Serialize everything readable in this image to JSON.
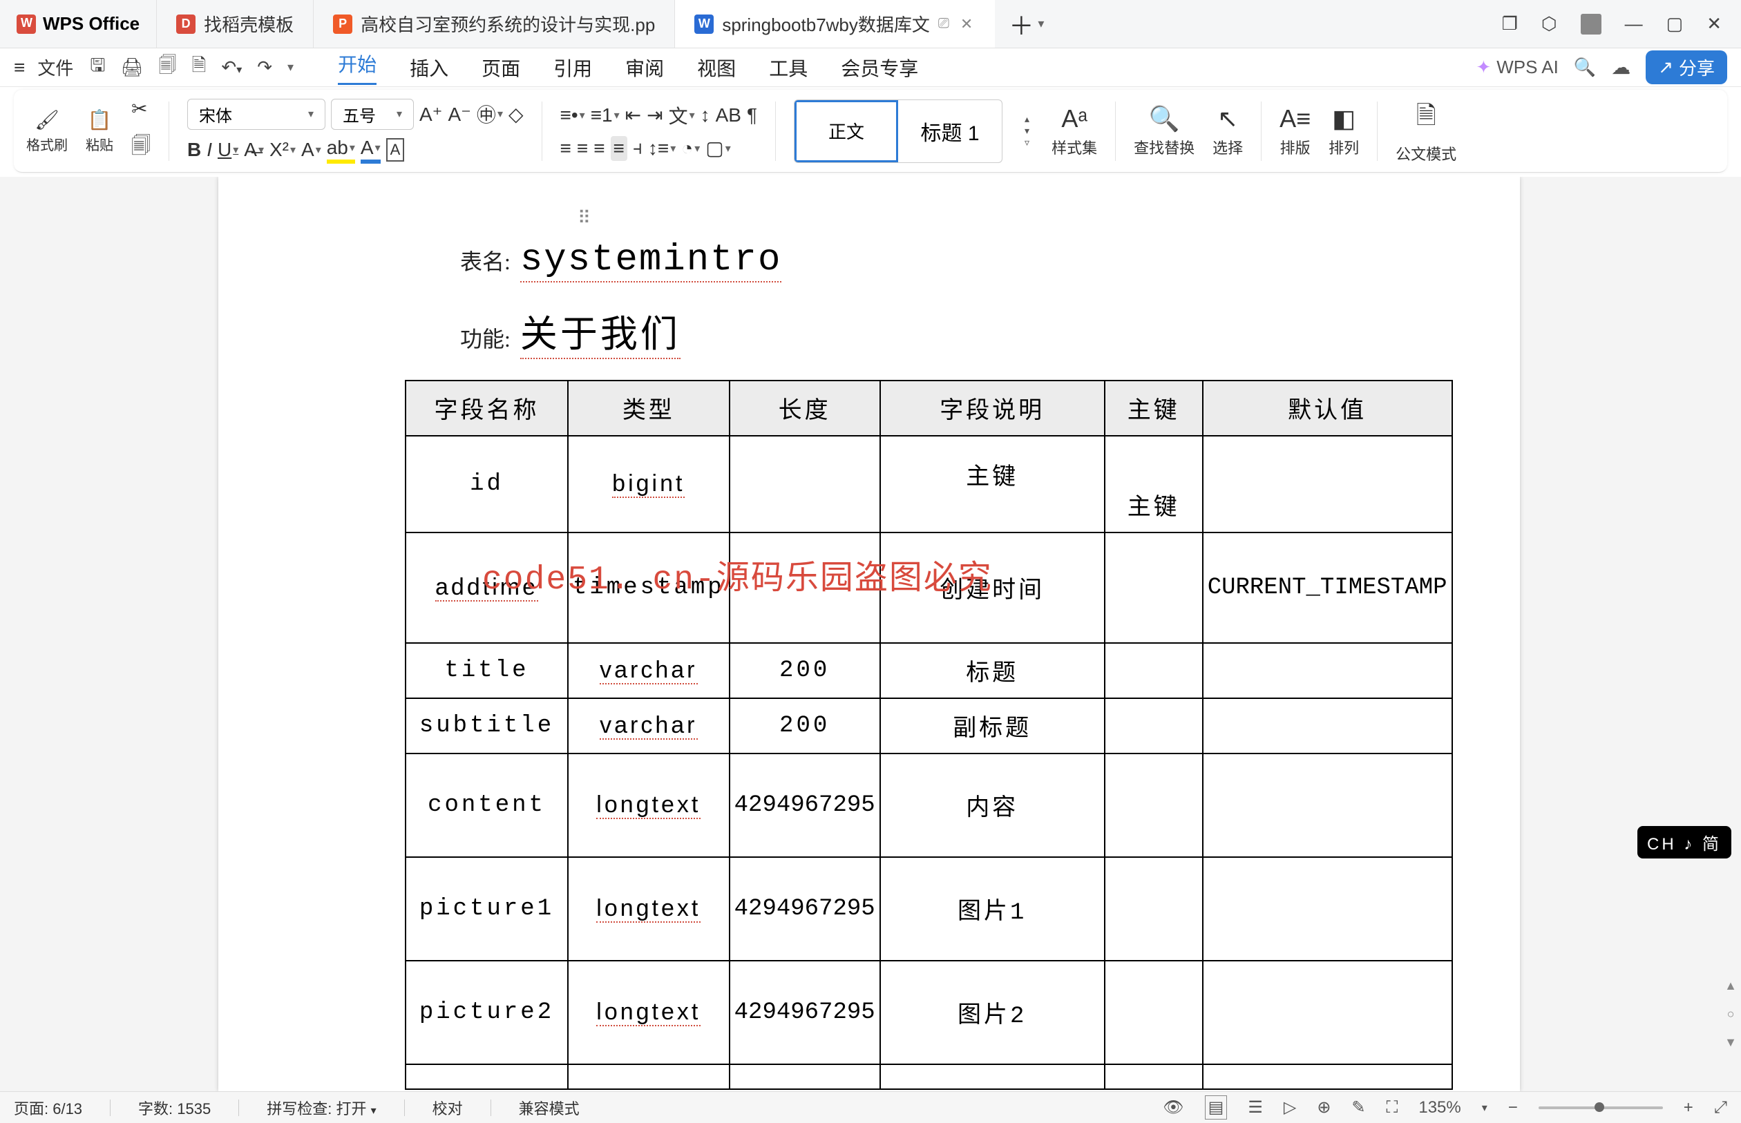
{
  "titlebar": {
    "app_name": "WPS Office",
    "tabs": [
      {
        "label": "找稻壳模板",
        "icon": "D",
        "color": "ic-red"
      },
      {
        "label": "高校自习室预约系统的设计与实现.pp",
        "icon": "P",
        "color": "ic-orange"
      },
      {
        "label": "springbootb7wby数据库文",
        "icon": "W",
        "color": "ic-blue",
        "active": true,
        "closable": true
      }
    ]
  },
  "quickbar": {
    "file_label": "文件",
    "menus": [
      "开始",
      "插入",
      "页面",
      "引用",
      "审阅",
      "视图",
      "工具",
      "会员专享"
    ],
    "active_menu": "开始",
    "ai_label": "WPS AI",
    "share_label": "分享"
  },
  "ribbon": {
    "format_brush": "格式刷",
    "paste": "粘贴",
    "font_name": "宋体",
    "font_size": "五号",
    "styles_a": "正文",
    "styles_b": "标题 1",
    "stylesets": "样式集",
    "find_replace": "查找替换",
    "select": "选择",
    "layout": "排版",
    "arrange": "排列",
    "officialdoc": "公文模式"
  },
  "document": {
    "table_label": "表名:",
    "table_name": "systemintro",
    "func_label": "功能:",
    "func_value": "关于我们",
    "watermark": "code51. cn-源码乐园盗图必究",
    "headers": [
      "字段名称",
      "类型",
      "长度",
      "字段说明",
      "主键",
      "默认值"
    ],
    "rows": [
      {
        "name": "id",
        "type": "bigint",
        "len": "",
        "desc": "主键",
        "pk": "主键",
        "def": ""
      },
      {
        "name": "addtime",
        "type": "timestamp",
        "len": "",
        "desc": "创建时间",
        "pk": "",
        "def": "CURRENT_TIMESTAMP"
      },
      {
        "name": "title",
        "type": "varchar",
        "len": "200",
        "desc": "标题",
        "pk": "",
        "def": ""
      },
      {
        "name": "subtitle",
        "type": "varchar",
        "len": "200",
        "desc": "副标题",
        "pk": "",
        "def": ""
      },
      {
        "name": "content",
        "type": "longtext",
        "len": "4294967295",
        "desc": "内容",
        "pk": "",
        "def": ""
      },
      {
        "name": "picture1",
        "type": "longtext",
        "len": "4294967295",
        "desc": "图片1",
        "pk": "",
        "def": ""
      },
      {
        "name": "picture2",
        "type": "longtext",
        "len": "4294967295",
        "desc": "图片2",
        "pk": "",
        "def": ""
      }
    ]
  },
  "ime": {
    "label": "CH ♪ 简"
  },
  "status": {
    "page": "页面: 6/13",
    "words": "字数: 1535",
    "spell": "拼写检查: 打开",
    "proof": "校对",
    "compat": "兼容模式",
    "zoom": "135%"
  }
}
